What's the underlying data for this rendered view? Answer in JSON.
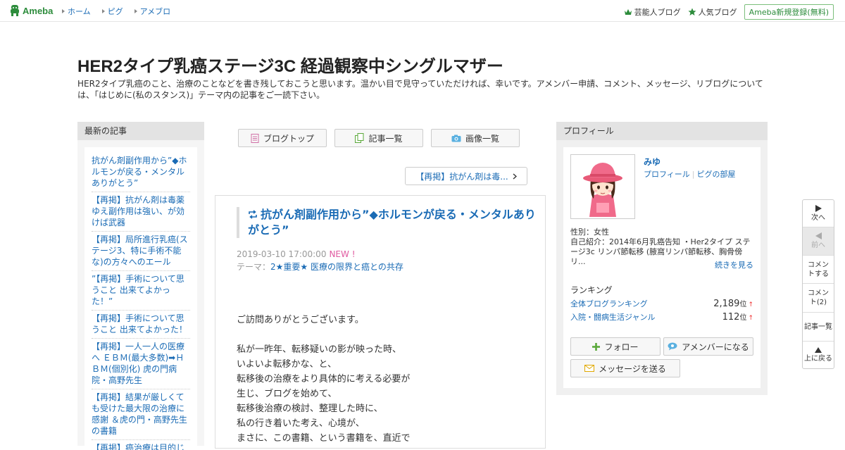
{
  "header": {
    "logo": "Ameba",
    "nav": [
      "ホーム",
      "ピグ",
      "アメブロ"
    ],
    "rank_links": [
      "芸能人ブログ",
      "人気ブログ"
    ],
    "register": "Ameba新規登録(無料)"
  },
  "blog": {
    "title": "HER2タイプ乳癌ステージ3C 経過観察中シングルマザー",
    "description": "HER2タイプ乳癌のこと、治療のことなどを書き残しておこうと思います。温かい目で見守っていただければ、幸いです。アメンバー申請、コメント、メッセージ、リブログについては、「はじめに(私のスタンス)」テーマ内の記事をご一読下さい。"
  },
  "recent": {
    "heading": "最新の記事",
    "items": [
      "抗がん剤副作用から”◆ホルモンが戻る・メンタルありがとう”",
      "【再掲】抗がん剤は毒薬ゆえ副作用は強い、が効けば武器",
      "【再掲】局所進行乳癌(ステージ3、特に手術不能な)の方々へのエール",
      "”【再掲】手術について思うこと 出来てよかった！”",
      "【再掲】手術について思うこと 出来てよかった！",
      "【再掲】一人一人の医療へ ＥＢＭ(最大多数)➡ＨＢＭ(個別化) 虎の門病院・高野先生",
      "【再掲】結果が厳しくても受けた最大限の治療に感謝 ＆虎の門・高野先生の書籍",
      "【再掲】癌治療は目的じゃない、自分らしく生き"
    ]
  },
  "nav": {
    "top": "ブログトップ",
    "list": "記事一覧",
    "images": "画像一覧",
    "prev_article": "【再掲】抗がん剤は毒..."
  },
  "article": {
    "title": "抗がん剤副作用から”◆ホルモンが戻る・メンタルありがとう”",
    "date": "2019-03-10 17:00:00",
    "new_badge": "NEW !",
    "theme_label": "テーマ：",
    "theme": "2★重要★ 医療の限界と癌との共存",
    "body": [
      "ご訪問ありがとうございます。",
      "",
      "私が一昨年、転移疑いの影が映った時、",
      "いよいよ転移かな、と、",
      "転移後の治療をより具体的に考える必要が",
      "生じ、ブログを始めて、",
      "転移後治療の検討、整理した時に、",
      "私の行き着いた考え、心境が、",
      "まさに、この書籍、という書籍を、直近で"
    ]
  },
  "profile": {
    "heading": "プロフィール",
    "name": "みゆ",
    "link_profile": "プロフィール",
    "link_room": "ピグの部屋",
    "gender": "性別：女性",
    "intro": "自己紹介：2014年6月乳癌告知 ・Her2タイプ ステージ3c リンパ節転移 (腋窩リンパ節転移、胸骨傍リ...",
    "more": "続きを見る",
    "ranking_heading": "ランキング",
    "rankings": [
      {
        "label": "全体ブログランキング",
        "value": "2,189",
        "unit": "位",
        "arrow": "↑"
      },
      {
        "label": "入院・闘病生活ジャンル",
        "value": "112",
        "unit": "位",
        "arrow": "↑"
      }
    ],
    "follow": "フォロー",
    "amember": "アメンバーになる",
    "message": "メッセージを送る"
  },
  "floatnav": {
    "next": "次へ",
    "prev": "前へ",
    "comment": "コメントする",
    "comments": "コメント(2)",
    "list": "記事一覧",
    "top": "上に戻る"
  },
  "colors": {
    "accent_green": "#2d8c3c",
    "link_blue": "#1a6bb5",
    "new_pink": "#e05aa0"
  }
}
